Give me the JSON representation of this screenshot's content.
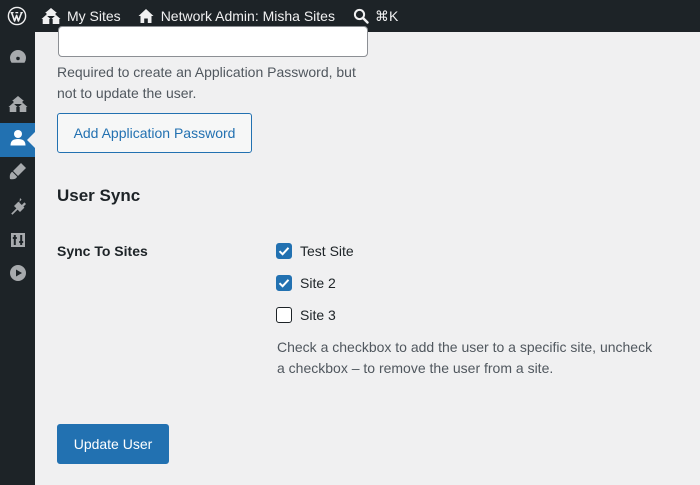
{
  "admin_bar": {
    "wp_logo_icon": "wordpress-logo-icon",
    "my_sites": {
      "icon": "my-sites-icon",
      "label": "My Sites"
    },
    "network_admin": {
      "icon": "home-icon",
      "label": "Network Admin: Misha Sites"
    },
    "search": {
      "icon": "search-icon",
      "shortcut": "⌘K"
    }
  },
  "side_menu": {
    "items": [
      {
        "icon": "dashboard-icon"
      },
      {
        "icon": "sites-icon"
      },
      {
        "icon": "users-icon",
        "current": true
      },
      {
        "icon": "themes-icon"
      },
      {
        "icon": "plugins-icon"
      },
      {
        "icon": "settings-icon"
      },
      {
        "icon": "media-play-icon"
      }
    ]
  },
  "app_password": {
    "input_value": "",
    "description": "Required to create an Application Password, but not to update the user.",
    "add_button_label": "Add Application Password"
  },
  "user_sync": {
    "section_title": "User Sync",
    "row_label": "Sync To Sites",
    "sites": [
      {
        "label": "Test Site",
        "checked": true
      },
      {
        "label": "Site 2",
        "checked": true
      },
      {
        "label": "Site 3",
        "checked": false
      }
    ],
    "description": "Check a checkbox to add the user to a specific site, uncheck a checkbox – to remove the user from a site."
  },
  "update_button_label": "Update User",
  "colors": {
    "admin_bar_bg": "#1d2327",
    "accent": "#2271b1",
    "page_bg": "#f0f0f1"
  }
}
